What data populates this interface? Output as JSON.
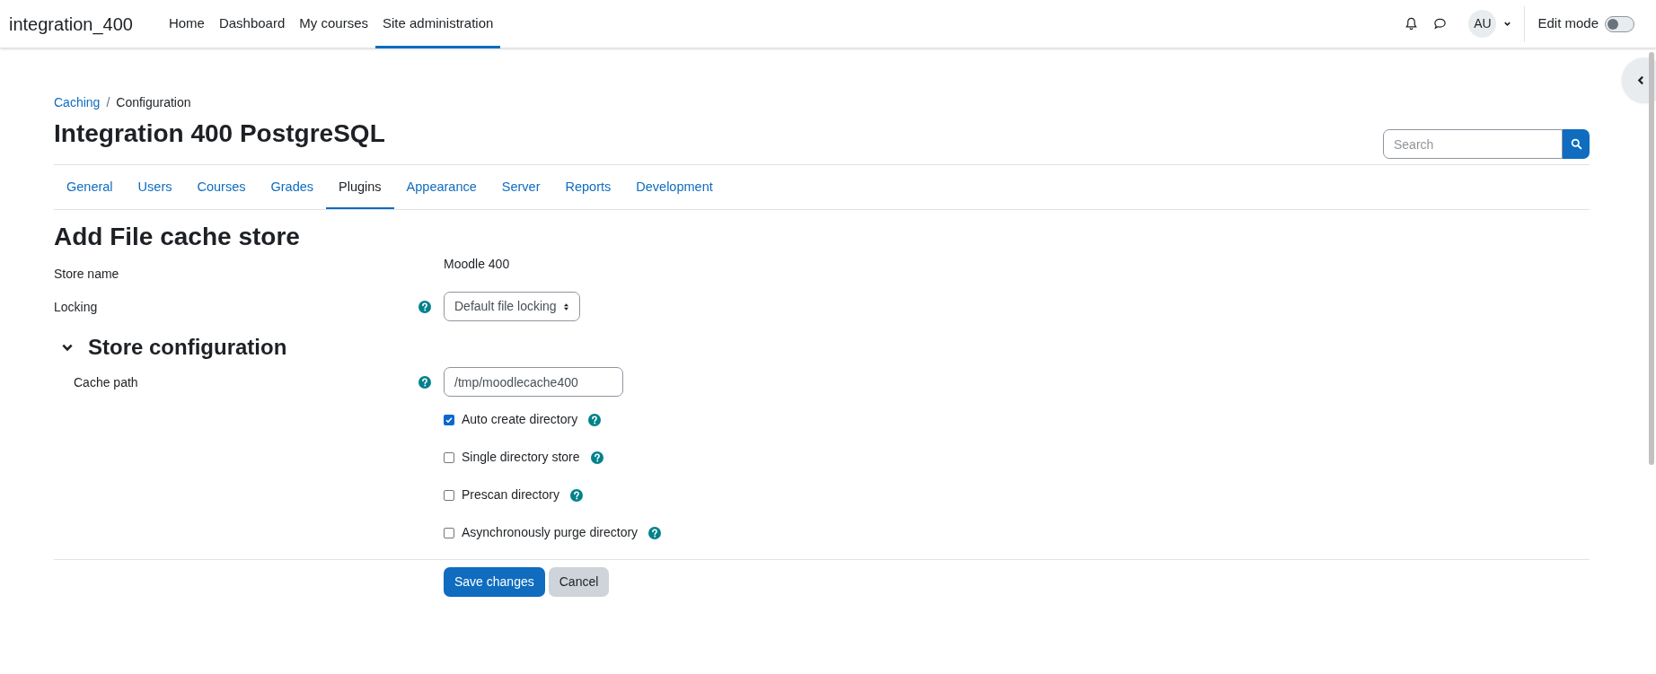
{
  "navbar": {
    "brand": "integration_400",
    "links": [
      {
        "label": "Home",
        "selected": false
      },
      {
        "label": "Dashboard",
        "selected": false
      },
      {
        "label": "My courses",
        "selected": false
      },
      {
        "label": "Site administration",
        "selected": true
      }
    ],
    "avatar": "AU",
    "edit_mode": {
      "label": "Edit mode",
      "on": false
    }
  },
  "breadcrumb": {
    "separator": "/",
    "items": [
      {
        "label": "Caching",
        "link": true
      },
      {
        "label": "Configuration",
        "link": false
      }
    ]
  },
  "page_title": "Integration 400 PostgreSQL",
  "search": {
    "placeholder": "Search"
  },
  "tabs": [
    {
      "label": "General",
      "selected": false
    },
    {
      "label": "Users",
      "selected": false
    },
    {
      "label": "Courses",
      "selected": false
    },
    {
      "label": "Grades",
      "selected": false
    },
    {
      "label": "Plugins",
      "selected": true
    },
    {
      "label": "Appearance",
      "selected": false
    },
    {
      "label": "Server",
      "selected": false
    },
    {
      "label": "Reports",
      "selected": false
    },
    {
      "label": "Development",
      "selected": false
    }
  ],
  "form": {
    "heading": "Add File cache store",
    "fields": [
      {
        "kind": "static",
        "label": "Store name",
        "help": false,
        "value": "Moodle 400"
      },
      {
        "kind": "select",
        "label": "Locking",
        "help": true,
        "value": "Default file locking"
      }
    ],
    "section": {
      "title": "Store configuration",
      "expanded": true,
      "fields": [
        {
          "kind": "text",
          "label": "Cache path",
          "help": true,
          "value": "/tmp/moodlecache400"
        },
        {
          "kind": "checkbox",
          "label": "Auto create directory",
          "help": true,
          "checked": true
        },
        {
          "kind": "checkbox",
          "label": "Single directory store",
          "help": true,
          "checked": false
        },
        {
          "kind": "checkbox",
          "label": "Prescan directory",
          "help": true,
          "checked": false
        },
        {
          "kind": "checkbox",
          "label": "Asynchronously purge directory",
          "help": true,
          "checked": false
        }
      ]
    },
    "buttons": [
      {
        "label": "Save changes",
        "kind": "primary"
      },
      {
        "label": "Cancel",
        "kind": "secondary"
      }
    ]
  }
}
